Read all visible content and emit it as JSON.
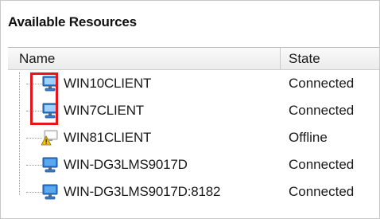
{
  "panel": {
    "title": "Available Resources"
  },
  "columns": {
    "name": "Name",
    "state": "State"
  },
  "rows": [
    {
      "name": "WIN10CLIENT",
      "state": "Connected",
      "icon": "computer-icon"
    },
    {
      "name": "WIN7CLIENT",
      "state": "Connected",
      "icon": "computer-icon"
    },
    {
      "name": "WIN81CLIENT",
      "state": "Offline",
      "icon": "computer-warning-icon"
    },
    {
      "name": "WIN-DG3LMS9017D",
      "state": "Connected",
      "icon": "computer-icon"
    },
    {
      "name": "WIN-DG3LMS9017D:8182",
      "state": "Connected",
      "icon": "computer-icon"
    }
  ],
  "colors": {
    "highlight": "#e8141b",
    "monitor_blue": "#2f7fd6"
  }
}
